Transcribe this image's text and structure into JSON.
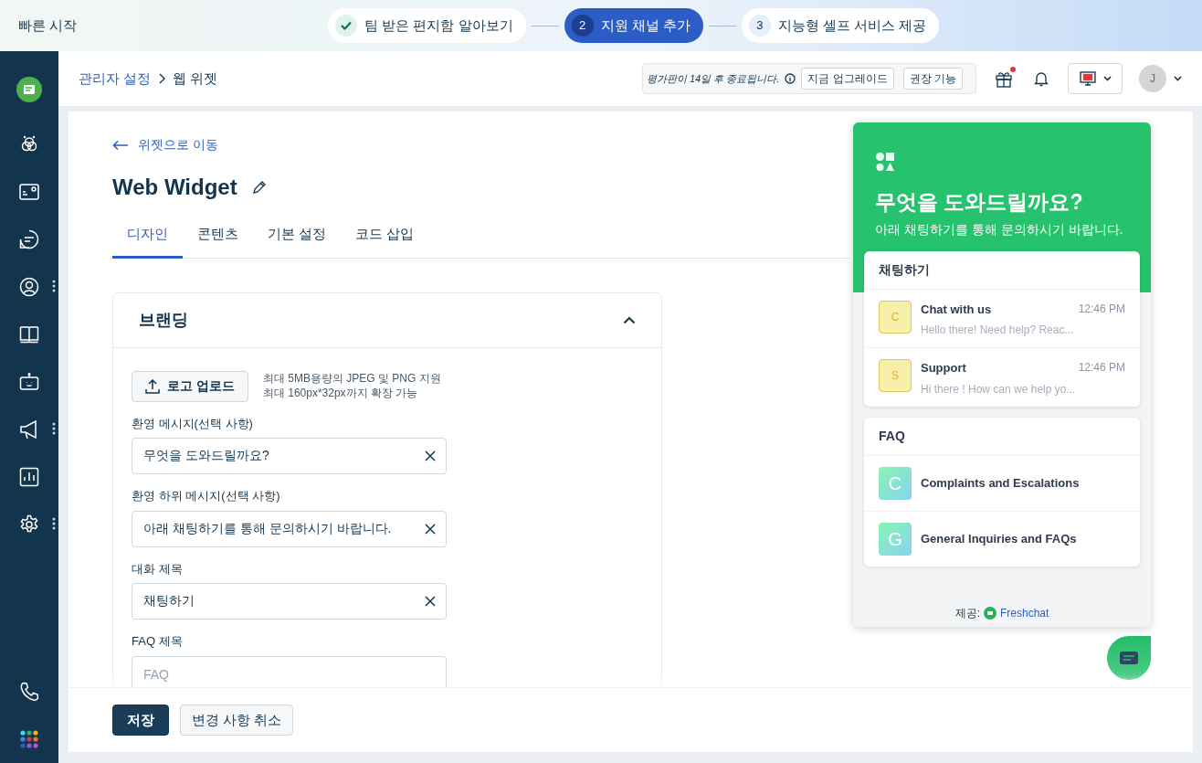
{
  "quick_start": {
    "title": "빠른 시작",
    "steps": [
      {
        "label": "팀 받은 편지함 알아보기",
        "done": true,
        "selected": false
      },
      {
        "number": "2",
        "label": "지원 채널 추가",
        "done": false,
        "selected": true
      },
      {
        "number": "3",
        "label": "지능형 셀프 서비스 제공",
        "done": false,
        "selected": false
      }
    ]
  },
  "sidebar": {
    "items": [
      {
        "kind": "omni",
        "more": false
      },
      {
        "kind": "inbox",
        "more": false
      },
      {
        "kind": "chat",
        "more": false
      },
      {
        "kind": "contact",
        "more": true
      },
      {
        "kind": "book",
        "more": false
      },
      {
        "kind": "bot",
        "more": false
      },
      {
        "kind": "megaphone",
        "more": true
      },
      {
        "kind": "report",
        "more": false
      },
      {
        "kind": "settings",
        "more": true
      }
    ],
    "bottom_items": [
      {
        "kind": "phone"
      },
      {
        "kind": "apps"
      }
    ]
  },
  "header": {
    "breadcrumb": [
      {
        "label": "관리자 설정",
        "link": true
      },
      {
        "label": "웹 위젯",
        "link": false
      }
    ],
    "trial_notice": "평가판이 14일 후 종료됩니다.",
    "trial_buttons": [
      "지금 업그레이드",
      "권장 기능"
    ],
    "gift_notification": true,
    "avatar_initial": "J"
  },
  "back_link": "위젯으로 이동",
  "title": "Web Widget",
  "tabs": [
    {
      "label": "디자인",
      "selected": true
    },
    {
      "label": "콘텐츠",
      "selected": false
    },
    {
      "label": "기본 설정",
      "selected": false
    },
    {
      "label": "코드 삽입",
      "selected": false
    }
  ],
  "section": {
    "title": "브랜딩",
    "expanded": true,
    "upload_button": "로고 업로드",
    "upload_hints": [
      "최대 5MB용량의 JPEG 및 PNG 지원",
      "최대 160px*32px까지 확장 가능"
    ],
    "fields": [
      {
        "label": "환영 메시지(선택 사항)",
        "value": "무엇을 도와드릴까요?",
        "clearable": true
      },
      {
        "label": "환영 하위 메시지(선택 사항)",
        "value": "아래 채팅하기를 통해 문의하시기 바랍니다.",
        "clearable": true
      },
      {
        "label": "대화 제목",
        "value": "채팅하기",
        "clearable": true
      },
      {
        "label": "FAQ 제목",
        "placeholder": "FAQ",
        "clearable": false
      }
    ]
  },
  "footer_buttons": [
    {
      "label": "저장",
      "kind": "primary"
    },
    {
      "label": "변경 사항 취소",
      "kind": "secondary"
    }
  ],
  "preview": {
    "heading": "무엇을 도와드릴까요?",
    "subheading": "아래 채팅하기를 통해 문의하시기 바랍니다.",
    "chat_title": "채팅하기",
    "conversations": [
      {
        "initial": "C",
        "name": "Chat with us",
        "time": "12:46 PM",
        "message": "Hello there! Need help? Reac..."
      },
      {
        "initial": "S",
        "name": "Support",
        "time": "12:46 PM",
        "message": "Hi there ! How can we help yo..."
      }
    ],
    "faq_title": "FAQ",
    "faq_items": [
      {
        "initial": "C",
        "title": "Complaints and Escalations"
      },
      {
        "initial": "G",
        "title": "General Inquiries and FAQs"
      }
    ],
    "powered_label": "제공:",
    "powered_brand": "Freshchat"
  }
}
